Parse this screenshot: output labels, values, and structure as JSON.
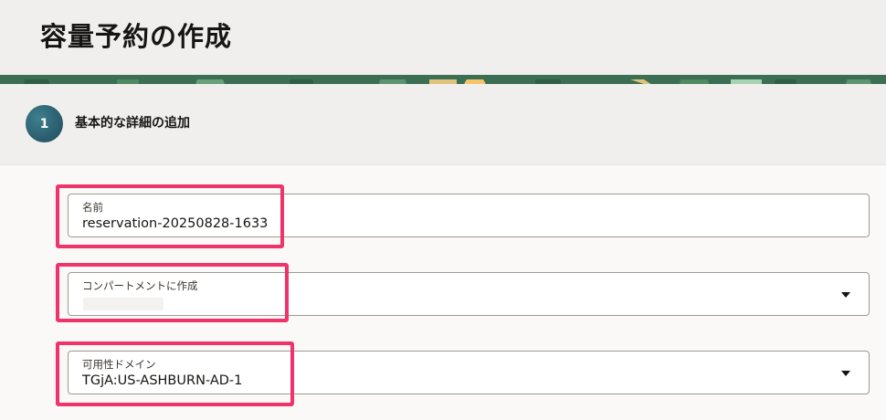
{
  "page": {
    "title": "容量予約の作成"
  },
  "step": {
    "number": "1",
    "label": "基本的な詳細の追加"
  },
  "form": {
    "name": {
      "label": "名前",
      "value": "reservation-20250828-1633"
    },
    "compartment": {
      "label": "コンパートメントに作成",
      "value": ""
    },
    "availability_domain": {
      "label": "可用性ドメイン",
      "value": "TGjA:US-ASHBURN-AD-1"
    }
  },
  "colors": {
    "highlight": "#f0336a",
    "step_circle": "#2b5f6f",
    "banner_green": "#3b6e53"
  },
  "icons": {
    "dropdown": "caret-down-icon"
  }
}
